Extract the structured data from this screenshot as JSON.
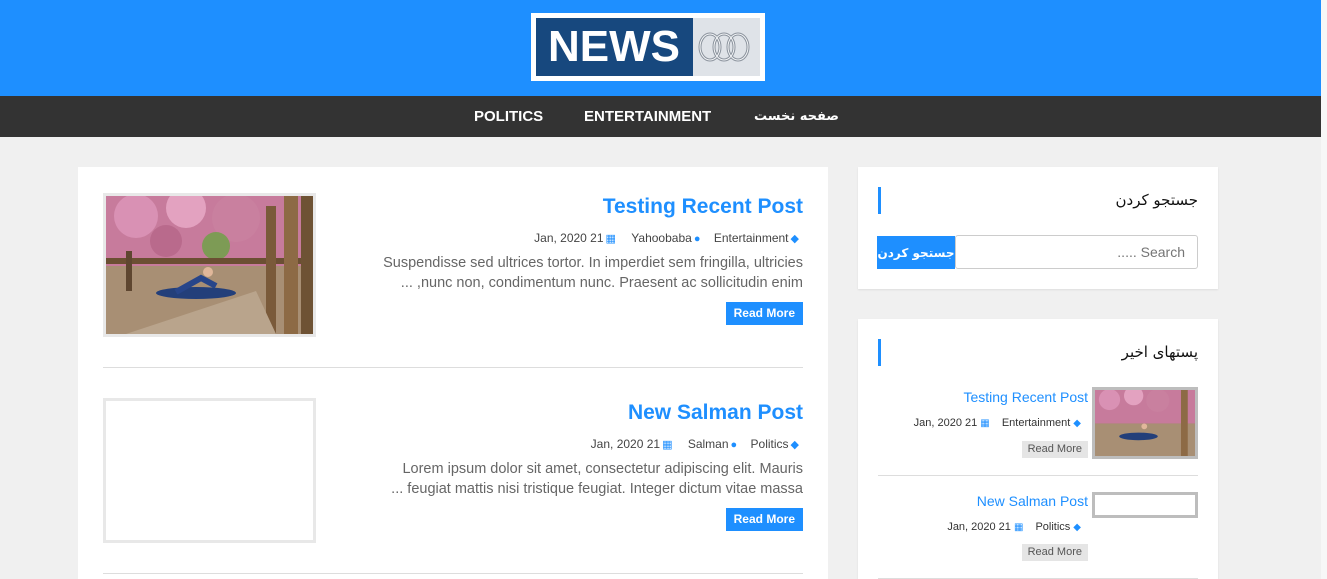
{
  "header": {
    "logo_text": "NEWS",
    "logo_mark_icon": "abc-lissajous-icon",
    "background_color": "#1e8fff"
  },
  "nav": {
    "items": [
      {
        "label": "POLITICS"
      },
      {
        "label": "ENTERTAINMENT"
      },
      {
        "label": "صفحه نخست"
      }
    ]
  },
  "posts": [
    {
      "title": "Testing Recent Post",
      "date": "Jan, 2020 21",
      "author": "Yahoobaba",
      "category": "Entertainment",
      "excerpt_line1": "Suspendisse sed ultrices tortor. In imperdiet sem fringilla, ultricies",
      "excerpt_line2": "... ,nunc non, condimentum nunc. Praesent ac sollicitudin enim",
      "read_more": "Read More",
      "has_image": true
    },
    {
      "title": "New Salman Post",
      "date": "Jan, 2020 21",
      "author": "Salman",
      "category": "Politics",
      "excerpt_line1": "Lorem ipsum dolor sit amet, consectetur adipiscing elit. Mauris",
      "excerpt_line2": "... feugiat mattis nisi tristique feugiat. Integer dictum vitae massa",
      "read_more": "Read More",
      "has_image": false
    }
  ],
  "sidebar": {
    "search": {
      "title": "جستجو کردن",
      "button_label": "جستجو کردن",
      "placeholder": "..... Search"
    },
    "recent": {
      "title": "پستهای اخیر",
      "items": [
        {
          "title": "Testing Recent Post",
          "date": "Jan, 2020 21",
          "category": "Entertainment",
          "read_more": "Read More"
        },
        {
          "title": "New Salman Post",
          "date": "Jan, 2020 21",
          "category": "Politics",
          "read_more": "Read More"
        }
      ]
    }
  },
  "colors": {
    "accent": "#1e8fff",
    "nav_bg": "#333333",
    "page_bg": "#f0f0f0"
  }
}
